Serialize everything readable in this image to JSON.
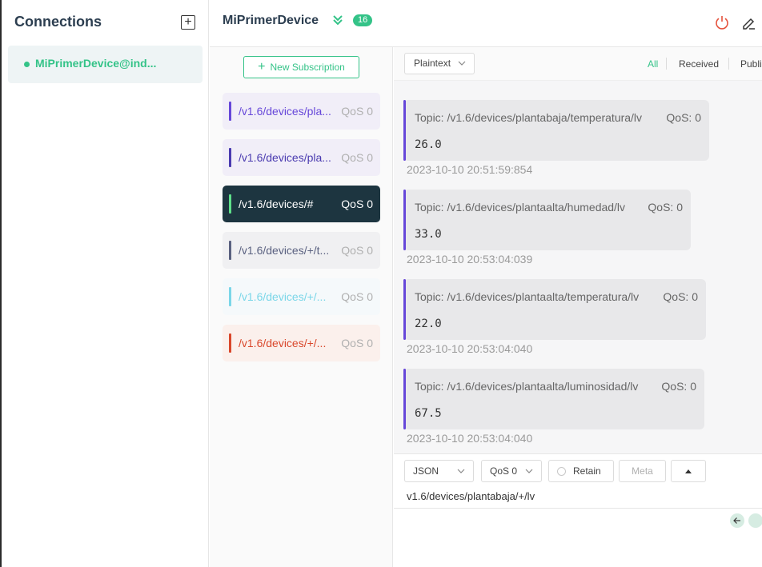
{
  "sidebar": {
    "title": "Connections",
    "connections": [
      {
        "name": "MiPrimerDevice@ind...",
        "status_color": "#34c388"
      }
    ]
  },
  "header": {
    "title": "MiPrimerDevice",
    "message_count": "16"
  },
  "subscriptions": {
    "new_button_label": "New Subscription",
    "items": [
      {
        "topic": "/v1.6/devices/pla...",
        "qos": "QoS 0",
        "color": "#6647d9",
        "text_color": "#6647d9",
        "bg": "#f1eef8"
      },
      {
        "topic": "/v1.6/devices/pla...",
        "qos": "QoS 0",
        "color": "#4a3bb0",
        "text_color": "#4a3bb0",
        "bg": "#f1eef8"
      },
      {
        "topic": "/v1.6/devices/#",
        "qos": "QoS 0",
        "color": "#5ee08a",
        "text_color": "#ffffff",
        "bg": "#1d3540",
        "active": true
      },
      {
        "topic": "/v1.6/devices/+/t...",
        "qos": "QoS 0",
        "color": "#5a6180",
        "text_color": "#5a6180",
        "bg": "#f0f0f2"
      },
      {
        "topic": "/v1.6/devices/+/...",
        "qos": "QoS 0",
        "color": "#7ad6e8",
        "text_color": "#7ad6e8",
        "bg": "#f5f9fb"
      },
      {
        "topic": "/v1.6/devices/+/...",
        "qos": "QoS 0",
        "color": "#d9472b",
        "text_color": "#d9472b",
        "bg": "#fbf0ec"
      }
    ]
  },
  "messages": {
    "format": "Plaintext",
    "filters": [
      "All",
      "Received",
      "Publi"
    ],
    "active_filter": "All",
    "items": [
      {
        "topic": "Topic: /v1.6/devices/plantabaja/temperatura/lv",
        "qos": "QoS: 0",
        "payload": "26.0",
        "time": "2023-10-10 20:51:59:854"
      },
      {
        "topic": "Topic: /v1.6/devices/plantaalta/humedad/lv",
        "qos": "QoS: 0",
        "payload": "33.0",
        "time": "2023-10-10 20:53:04:039"
      },
      {
        "topic": "Topic: /v1.6/devices/plantaalta/temperatura/lv",
        "qos": "QoS: 0",
        "payload": "22.0",
        "time": "2023-10-10 20:53:04:040"
      },
      {
        "topic": "Topic: /v1.6/devices/plantaalta/luminosidad/lv",
        "qos": "QoS: 0",
        "payload": "67.5",
        "time": "2023-10-10 20:53:04:040"
      }
    ]
  },
  "publish": {
    "format": "JSON",
    "qos": "QoS 0",
    "retain_label": "Retain",
    "meta_label": "Meta",
    "topic": "v1.6/devices/plantabaja/+/lv"
  },
  "colors": {
    "accent": "#34c388",
    "message_bar": "#6647d9",
    "power": "#e5533d"
  }
}
